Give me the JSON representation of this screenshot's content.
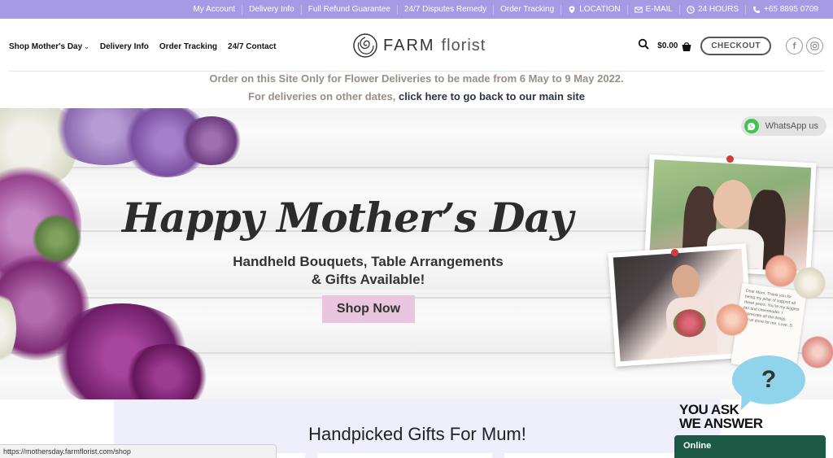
{
  "topbar": {
    "items": [
      {
        "label": "My Account",
        "icon": ""
      },
      {
        "label": "Delivery Info",
        "icon": ""
      },
      {
        "label": "Full Refund Guarantee",
        "icon": ""
      },
      {
        "label": "24/7 Disputes Remedy",
        "icon": ""
      },
      {
        "label": "Order Tracking",
        "icon": ""
      },
      {
        "label": "LOCATION",
        "icon": "location-pin-icon"
      },
      {
        "label": "E-MAIL",
        "icon": "envelope-icon"
      },
      {
        "label": "24 HOURS",
        "icon": "clock-icon"
      },
      {
        "label": "+65 8895 0709",
        "icon": "phone-icon"
      }
    ],
    "background": "#a79ae5"
  },
  "nav": {
    "items": [
      "Shop Mother's Day",
      "Delivery Info",
      "Order Tracking",
      "24/7 Contact"
    ]
  },
  "logo": {
    "farm": "FARM",
    "florist": "florist"
  },
  "cart": {
    "total": "$0.00",
    "checkout_label": "CHECKOUT"
  },
  "social": {
    "facebook": "f",
    "instagram": "ig"
  },
  "notice": {
    "line1": "Order on this Site Only for Flower Deliveries to be made from 6 May to 9 May 2022.",
    "line2_prefix": "For deliveries on other dates, ",
    "line2_link": "click here to go back to our main site"
  },
  "hero": {
    "title": "Happy Mother’s Day",
    "subtitle_line1": "Handheld Bouquets, Table Arrangements",
    "subtitle_line2": "& Gifts Available!",
    "shop_button": "Shop Now",
    "whatsapp_label": "WhatsApp us",
    "card_text": "Dear Mum, Thank you for being my pillar of support all these years. You're my biggest fan and cheerleader. I appreciate all the things you've done for me. Love, D"
  },
  "ask": {
    "line1": "YOU ASK",
    "line2": "WE ANSWER",
    "bubble": "?"
  },
  "section": {
    "title": "Handpicked Gifts For Mum!"
  },
  "status_bar": {
    "url": "https://mothersday.farmflorist.com/shop"
  },
  "chat": {
    "status": "Online"
  }
}
